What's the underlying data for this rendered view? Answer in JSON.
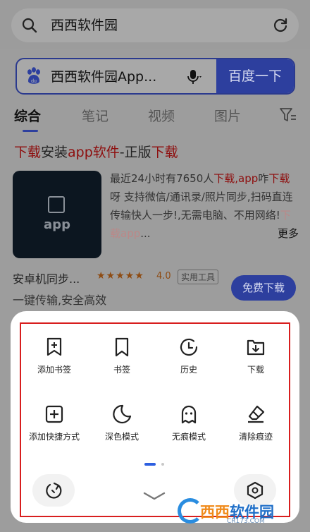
{
  "address_bar": {
    "text": "西西软件园"
  },
  "search": {
    "query": "西西软件园App...",
    "button": "百度一下"
  },
  "tabs": [
    {
      "label": "综合",
      "active": true
    },
    {
      "label": "笔记",
      "active": false
    },
    {
      "label": "视频",
      "active": false
    },
    {
      "label": "图片",
      "active": false
    }
  ],
  "result": {
    "title_parts": [
      "下载",
      "安装",
      "app软件",
      "-正版",
      "下载"
    ],
    "thumb_text": "app",
    "desc_parts": [
      "最近24小时有7650人",
      "下载",
      ",app",
      "咋",
      "下载",
      "呀 支持微信/通讯录/照片同步,扫码直连传输快人一步!,无需电脑、不用网络!",
      "下载app",
      "...",
      "更多"
    ],
    "app_name": "安卓机同步...",
    "stars": "★★★★★",
    "rating": "4.0",
    "tag": "实用工具",
    "subtitle": "一键传输,安全高效",
    "download_button": "免费下载"
  },
  "menu": {
    "items": [
      {
        "label": "添加书签",
        "icon": "add-bookmark-icon"
      },
      {
        "label": "书签",
        "icon": "bookmark-icon"
      },
      {
        "label": "历史",
        "icon": "history-icon"
      },
      {
        "label": "下载",
        "icon": "download-icon"
      },
      {
        "label": "添加快捷方式",
        "icon": "add-shortcut-icon"
      },
      {
        "label": "深色模式",
        "icon": "dark-mode-icon"
      },
      {
        "label": "无痕模式",
        "icon": "incognito-icon"
      },
      {
        "label": "清除痕迹",
        "icon": "clear-traces-icon"
      }
    ],
    "page_count": 2,
    "active_page": 1
  },
  "watermark": {
    "brand_a": "西西",
    "brand_b": "软件园",
    "url": "CR173.COM"
  },
  "colors": {
    "accent": "#2d3f9e",
    "highlight": "#8e0e0e",
    "frame": "#d81e1e"
  }
}
